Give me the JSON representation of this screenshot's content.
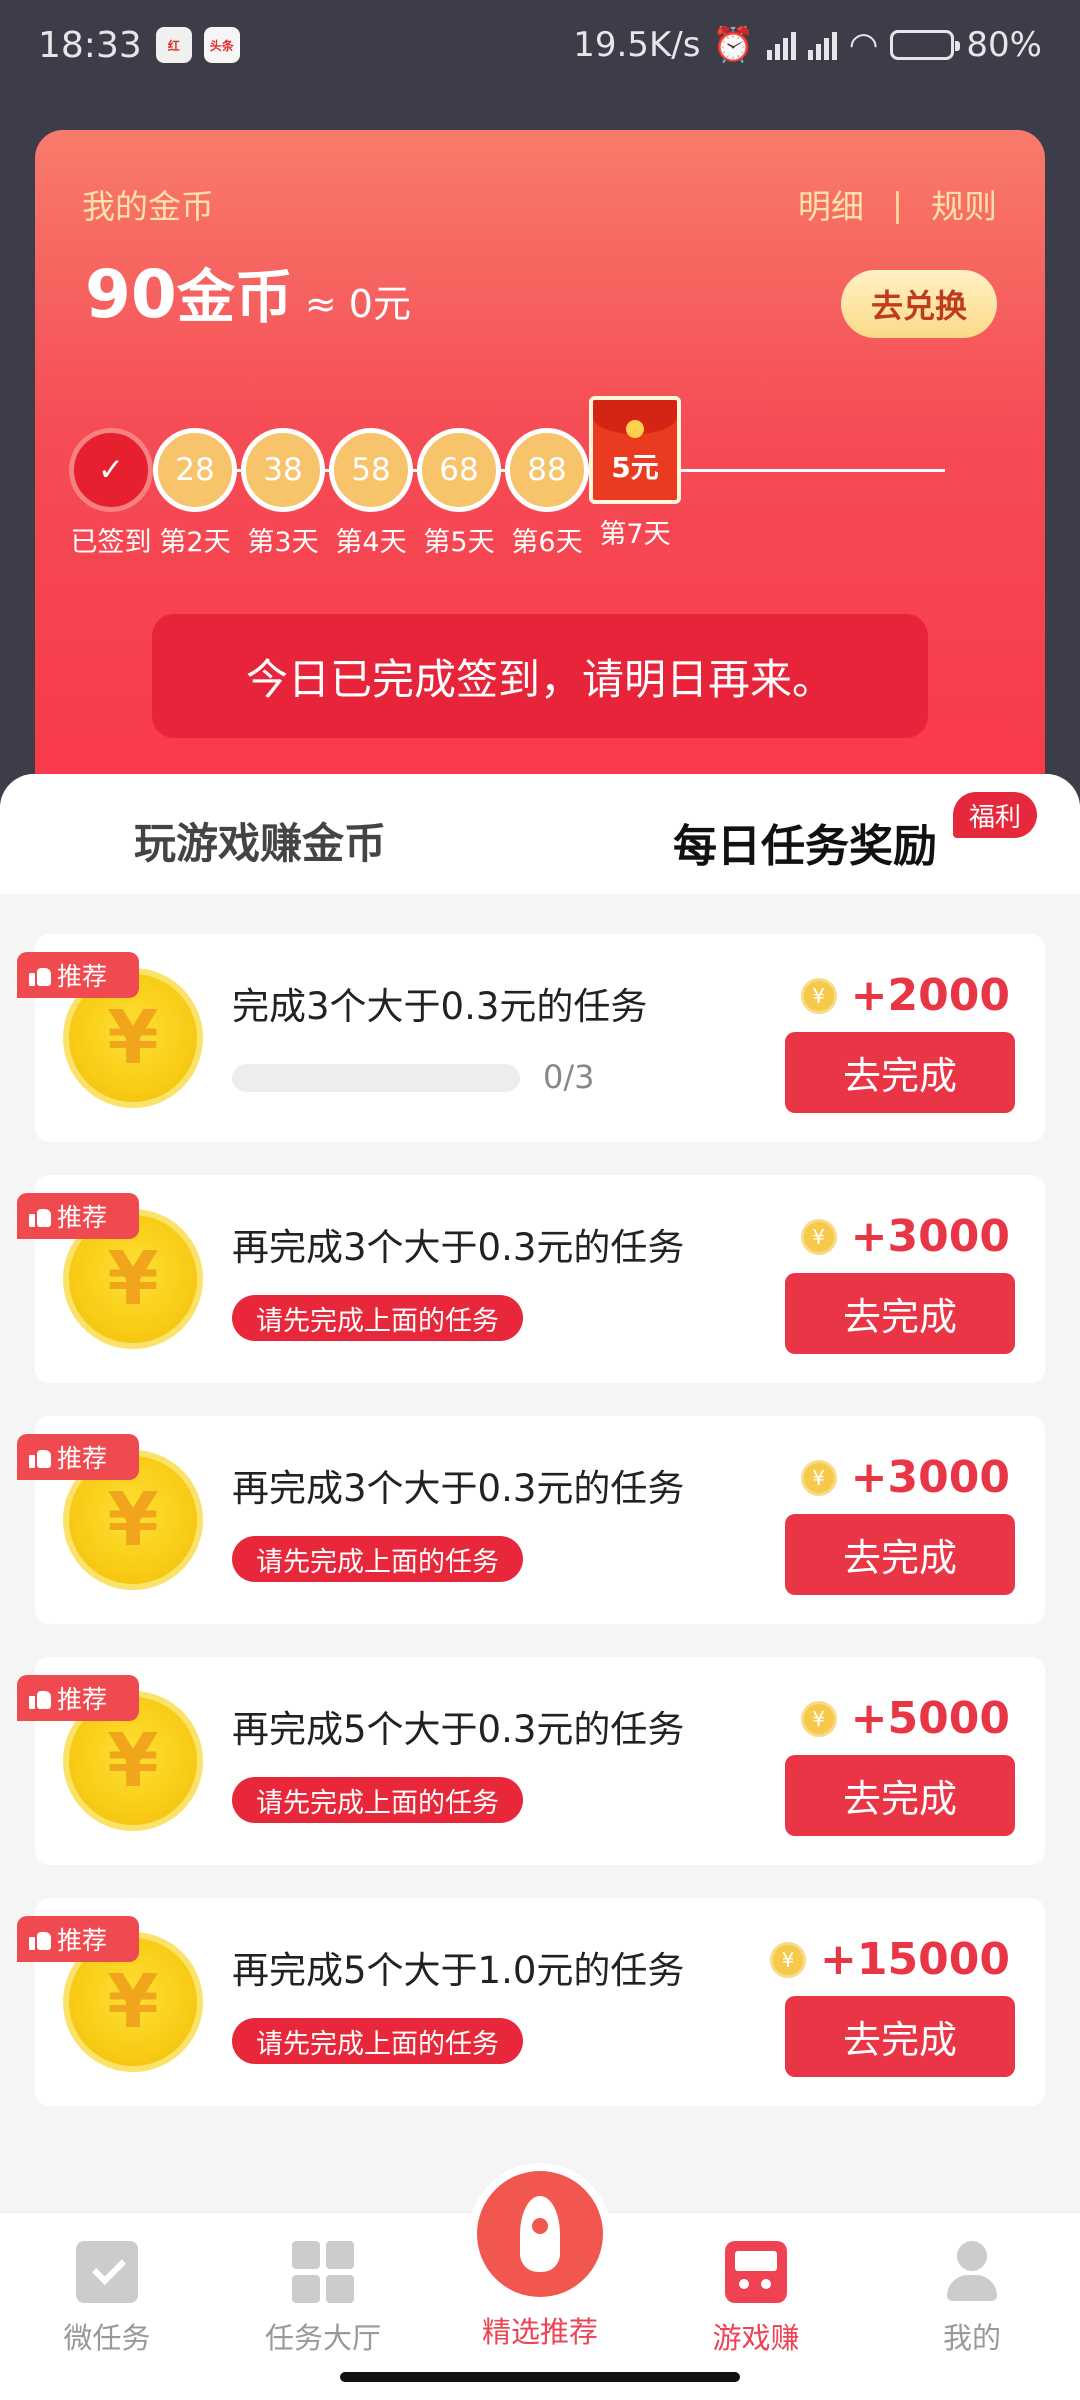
{
  "status": {
    "time": "18:33",
    "app1": "红",
    "app2": "头条",
    "speed": "19.5K/s",
    "battery": "80%",
    "battery_level": 0.8
  },
  "coin_card": {
    "label": "我的金币",
    "detail_link": "明细",
    "separator": "|",
    "rules_link": "规则",
    "coins": "90",
    "coin_unit": "金币",
    "approx": "≈ 0元",
    "exchange_label": "去兑换"
  },
  "checkin": {
    "days": [
      {
        "value": "",
        "label": "已签到",
        "done": true
      },
      {
        "value": "28",
        "label": "第2天"
      },
      {
        "value": "38",
        "label": "第3天"
      },
      {
        "value": "58",
        "label": "第4天"
      },
      {
        "value": "68",
        "label": "第5天"
      },
      {
        "value": "88",
        "label": "第6天"
      },
      {
        "value": "5元",
        "label": "第7天",
        "envelope": true
      }
    ],
    "banner": "今日已完成签到，请明日再来。"
  },
  "tabs": {
    "game": "玩游戏赚金币",
    "daily": "每日任务奖励",
    "welfare_badge": "福利"
  },
  "tasks": [
    {
      "title": "完成3个大于0.3元的任务",
      "tag": "推荐",
      "reward": "+2000",
      "button": "去完成",
      "progress_text": "0/3",
      "progress": 0
    },
    {
      "title": "再完成3个大于0.3元的任务",
      "tag": "推荐",
      "reward": "+3000",
      "button": "去完成",
      "lock": "请先完成上面的任务"
    },
    {
      "title": "再完成3个大于0.3元的任务",
      "tag": "推荐",
      "reward": "+3000",
      "button": "去完成",
      "lock": "请先完成上面的任务"
    },
    {
      "title": "再完成5个大于0.3元的任务",
      "tag": "推荐",
      "reward": "+5000",
      "button": "去完成",
      "lock": "请先完成上面的任务"
    },
    {
      "title": "再完成5个大于1.0元的任务",
      "tag": "推荐",
      "reward": "+15000",
      "button": "去完成",
      "lock": "请先完成上面的任务"
    }
  ],
  "coin_symbol": "¥",
  "nav": {
    "items": [
      {
        "label": "微任务",
        "icon": "task-icon"
      },
      {
        "label": "任务大厅",
        "icon": "grid-icon"
      },
      {
        "label": "精选推荐",
        "icon": "rocket-icon"
      },
      {
        "label": "游戏赚",
        "icon": "game-icon",
        "active": true
      },
      {
        "label": "我的",
        "icon": "user-icon"
      }
    ]
  },
  "colors": {
    "accent": "#e93545",
    "card_top": "#f87b6b",
    "card_bottom": "#f9394a",
    "gold": "#f8cc17"
  }
}
